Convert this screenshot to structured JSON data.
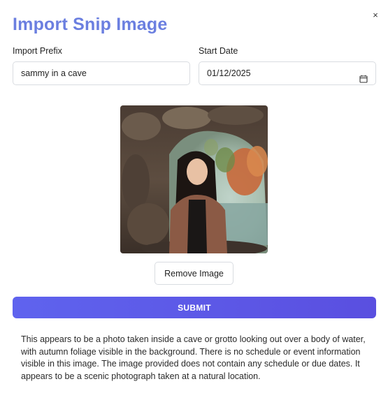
{
  "dialog": {
    "title": "Import Snip Image",
    "close_label": "×"
  },
  "form": {
    "prefix_label": "Import Prefix",
    "prefix_value": "sammy in a cave",
    "date_label": "Start Date",
    "date_value": "01/12/2025"
  },
  "image": {
    "alt": "Photo of a woman in a cave looking out over water with autumn foliage"
  },
  "buttons": {
    "remove_label": "Remove Image",
    "submit_label": "SUBMIT"
  },
  "result": {
    "text": "This appears to be a photo taken inside a cave or grotto looking out over a body of water, with autumn foliage visible in the background. There is no schedule or event information visible in this image. The image provided does not contain any schedule or due dates. It appears to be a scenic photograph taken at a natural location."
  },
  "icons": {
    "close": "close-icon",
    "calendar": "calendar-icon"
  },
  "colors": {
    "title": "#6b7fe0",
    "submit_start": "#5f63ee",
    "submit_end": "#5a4fe0"
  }
}
